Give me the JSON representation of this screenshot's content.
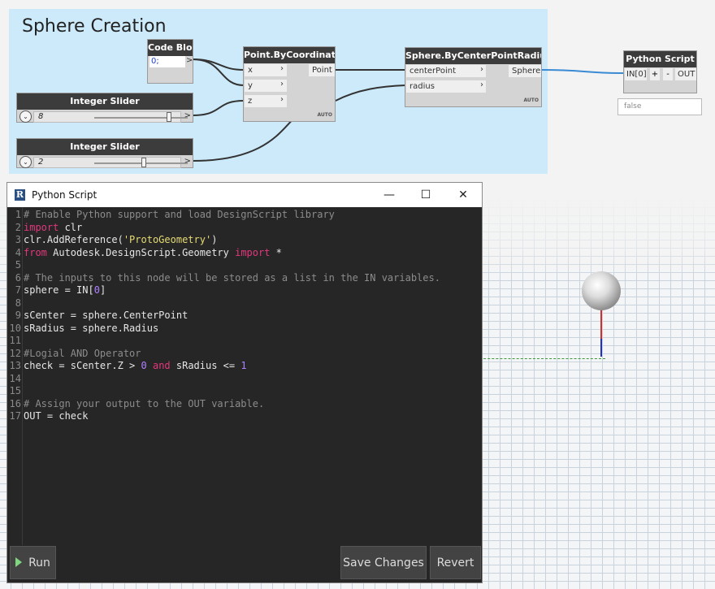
{
  "group": {
    "title": "Sphere Creation"
  },
  "nodes": {
    "code_block": {
      "title": "Code Block",
      "code": "0;",
      "out": ">"
    },
    "point": {
      "title": "Point.ByCoordinates",
      "inputs": [
        "x",
        "y",
        "z"
      ],
      "output": "Point",
      "lacing": "AUTO"
    },
    "sphere": {
      "title": "Sphere.ByCenterPointRadius",
      "inputs": [
        "centerPoint",
        "radius"
      ],
      "output": "Sphere",
      "lacing": "AUTO"
    },
    "slider1": {
      "title": "Integer Slider",
      "value": "8",
      "level": 0.8
    },
    "slider2": {
      "title": "Integer Slider",
      "value": "2",
      "level": 0.53
    },
    "python": {
      "title": "Python Script",
      "input": "IN[0]",
      "add": "+",
      "remove": "-",
      "output": "OUT"
    }
  },
  "preview": {
    "value": "false"
  },
  "editor": {
    "title": "Python Script",
    "window_controls": {
      "minimize": "—",
      "maximize": "☐",
      "close": "✕"
    },
    "lines": [
      {
        "n": "1",
        "text": "# Enable Python support and load DesignScript library"
      },
      {
        "n": "2",
        "text": "import clr"
      },
      {
        "n": "3",
        "text": "clr.AddReference('ProtoGeometry')"
      },
      {
        "n": "4",
        "text": "from Autodesk.DesignScript.Geometry import *"
      },
      {
        "n": "5",
        "text": ""
      },
      {
        "n": "6",
        "text": "# The inputs to this node will be stored as a list in the IN variables."
      },
      {
        "n": "7",
        "text": "sphere = IN[0]"
      },
      {
        "n": "8",
        "text": ""
      },
      {
        "n": "9",
        "text": "sCenter = sphere.CenterPoint"
      },
      {
        "n": "10",
        "text": "sRadius = sphere.Radius"
      },
      {
        "n": "11",
        "text": ""
      },
      {
        "n": "12",
        "text": "#Logial AND Operator"
      },
      {
        "n": "13",
        "text": "check = sCenter.Z > 0 and sRadius <= 1"
      },
      {
        "n": "14",
        "text": ""
      },
      {
        "n": "15",
        "text": ""
      },
      {
        "n": "16",
        "text": "# Assign your output to the OUT variable."
      },
      {
        "n": "17",
        "text": "OUT = check"
      }
    ],
    "buttons": {
      "run": "Run",
      "save": "Save Changes",
      "revert": "Revert"
    }
  },
  "colors": {
    "group_bg": "#cdeafb",
    "wire": "#333333",
    "python_wire": "#3a8ad4",
    "editor_bg": "#262626",
    "keyword": "#e2377c",
    "string": "#e6db74",
    "number": "#ae81ff",
    "comment": "#8c8c8c"
  },
  "icons": [
    "revit-logo-icon",
    "minimize-icon",
    "maximize-icon",
    "close-icon",
    "run-play-icon",
    "slider-chevron-icon"
  ]
}
